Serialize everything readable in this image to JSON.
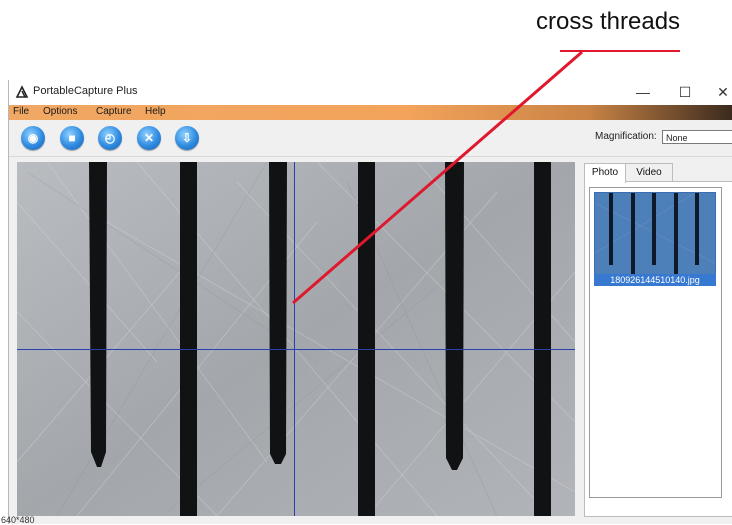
{
  "annotation": {
    "text": "cross threads",
    "line_color": "#e0182e"
  },
  "window": {
    "title": "PortableCapture Plus",
    "controls": {
      "minimize": "—",
      "maximize": "☐",
      "close": "✕"
    }
  },
  "menu": {
    "items": [
      "File",
      "Options",
      "Capture",
      "Help"
    ]
  },
  "toolbar": {
    "buttons": [
      {
        "name": "snapshot-icon",
        "glyph": "◉"
      },
      {
        "name": "video-camera-icon",
        "glyph": "■"
      },
      {
        "name": "timer-icon",
        "glyph": "◴"
      },
      {
        "name": "fullscreen-icon",
        "glyph": "✕"
      },
      {
        "name": "download-icon",
        "glyph": "⇩"
      }
    ],
    "magnification_label": "Magnification:",
    "magnification_value": "None"
  },
  "side_panel": {
    "tabs": [
      "Photo",
      "Video"
    ],
    "active_tab": "Photo",
    "thumbnail_filename": "180926144510140.jpg"
  },
  "status": {
    "resolution": "640*480"
  },
  "colors": {
    "crosshair": "#2a3fb0",
    "menubar_accent": "#f3a35a",
    "selection": "#3779d0"
  }
}
